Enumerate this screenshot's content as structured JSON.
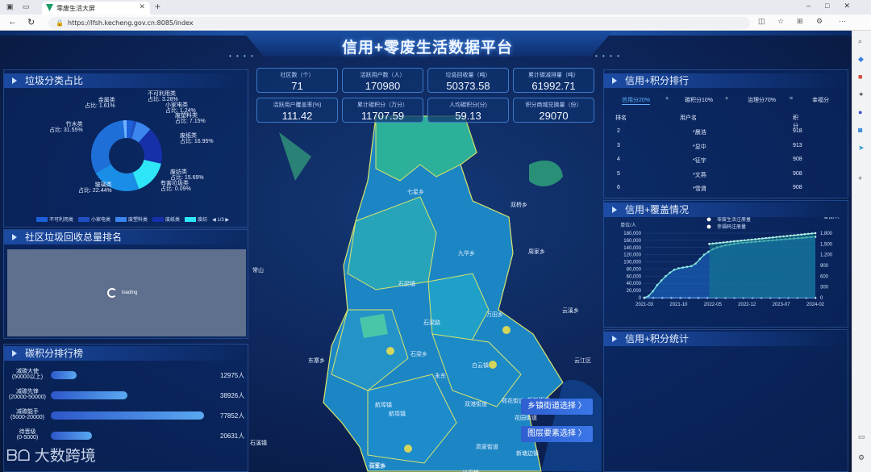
{
  "browser": {
    "tab_title": "零废生活大屏",
    "url": "https://lfsh.kecheng.gov.cn:8085/index"
  },
  "header": {
    "title": "信用+零废生活数据平台"
  },
  "stats": [
    {
      "label": "社区数（个）",
      "value": "71"
    },
    {
      "label": "活跃用户数（人）",
      "value": "170980"
    },
    {
      "label": "垃圾回收量（吨）",
      "value": "50373.58"
    },
    {
      "label": "累计碳减排量（吨）",
      "value": "61992.71"
    },
    {
      "label": "活跃用户覆盖率(%)",
      "value": "111.42"
    },
    {
      "label": "累计碳积分（万分）",
      "value": "11707.59"
    },
    {
      "label": "人均碳积分(分)",
      "value": "59.13"
    },
    {
      "label": "积分商城兑换量（份）",
      "value": "29070"
    }
  ],
  "waste_panel": {
    "title": "垃圾分类占比",
    "slices": [
      {
        "name": "不可利用类",
        "pct": "占比: 3.28%",
        "value": 3.28,
        "color": "#1d5fd8"
      },
      {
        "name": "小家电类",
        "pct": "占比: 1.24%",
        "value": 1.24,
        "color": "#1f4fc0"
      },
      {
        "name": "废塑料类",
        "pct": "占比: 7.15%",
        "value": 7.15,
        "color": "#3a85ee"
      },
      {
        "name": "废纸类",
        "pct": "占比: 16.95%",
        "value": 16.95,
        "color": "#1530a8"
      },
      {
        "name": "废纺类",
        "pct": "占比: 15.69%",
        "value": 15.69,
        "color": "#2ee6f7"
      },
      {
        "name": "有害垃圾类",
        "pct": "占比: 0.09%",
        "value": 0.09,
        "color": "#52c7ff"
      },
      {
        "name": "玻璃类",
        "pct": "占比: 22.44%",
        "value": 22.44,
        "color": "#1a8ee6"
      },
      {
        "name": "竹木类",
        "pct": "占比: 31.55%",
        "value": 31.55,
        "color": "#1e70d8"
      },
      {
        "name": "金属类",
        "pct": "占比: 1.61%",
        "value": 1.61,
        "color": "#6fb4ff"
      }
    ],
    "legend": [
      "不可利用类",
      "小家电类",
      "废塑料类",
      "废纸类",
      "废纺"
    ],
    "legend_page": "1/3"
  },
  "community_panel": {
    "title": "社区垃圾回收总量排名",
    "loading": "loading"
  },
  "carbon_panel": {
    "title": "碳积分排行榜",
    "rows": [
      {
        "name": "减碳大使",
        "range": "(50000以上)",
        "value": "12975人",
        "frac": 0.17
      },
      {
        "name": "减碳先锋",
        "range": "(20000-50000)",
        "value": "38926人",
        "frac": 0.5
      },
      {
        "name": "减碳能手",
        "range": "(5000-20000)",
        "value": "77852人",
        "frac": 1.0
      },
      {
        "name": "待晋级",
        "range": "(0-5000)",
        "value": "20631人",
        "frac": 0.27
      }
    ]
  },
  "rank_panel": {
    "title": "信用+积分排行",
    "formula": [
      "信用分20%",
      "+",
      "碳积分10%",
      "+",
      "治理分70%",
      "=",
      "幸福分"
    ],
    "headers": [
      "排名",
      "用户名",
      "积分"
    ],
    "rows": [
      {
        "rank": "2",
        "user": "*晨浩",
        "score": "918"
      },
      {
        "rank": "3",
        "user": "*显中",
        "score": "913"
      },
      {
        "rank": "4",
        "user": "*征宇",
        "score": "908"
      },
      {
        "rank": "5",
        "user": "*文燕",
        "score": "908"
      },
      {
        "rank": "6",
        "user": "*雪渭",
        "score": "908"
      }
    ]
  },
  "coverage_panel": {
    "title": "信用+覆盖情况"
  },
  "chart_data": {
    "type": "line",
    "series": [
      {
        "name": "零废生活注册量",
        "axis": "left"
      },
      {
        "name": "幸福码注册量",
        "axis": "right"
      }
    ],
    "ylabel_left": "单位/人",
    "ylabel_right": "单位/人",
    "y_ticks_left": [
      "180,000",
      "160,000",
      "140,000",
      "120,000",
      "100,000",
      "80,000",
      "60,000",
      "40,000",
      "20,000",
      "0"
    ],
    "y_ticks_right": [
      "1,800",
      "1,500",
      "1,200",
      "900",
      "600",
      "300",
      "0"
    ],
    "x_ticks": [
      "2021-03",
      "2021-10",
      "2022-05",
      "2022-12",
      "2023-07",
      "2024-02"
    ],
    "ylim_left": [
      0,
      180000
    ],
    "ylim_right": [
      0,
      1800
    ],
    "zero_series": [
      0,
      0,
      0,
      0,
      0,
      0,
      0,
      0,
      0,
      0,
      0,
      0,
      0,
      0,
      0,
      0,
      0,
      0,
      0,
      0,
      0,
      0,
      0,
      0,
      0,
      0,
      0,
      0,
      0,
      0,
      0,
      0,
      0,
      0,
      0,
      0,
      0,
      0,
      0,
      0,
      0,
      0,
      0,
      0,
      0,
      0,
      0,
      0,
      0,
      0,
      0,
      0,
      0,
      0,
      0,
      0,
      0,
      0,
      0,
      0
    ],
    "left_series": [
      0,
      5000,
      18000,
      35000,
      48000,
      60000,
      70000,
      78000,
      82000,
      84000,
      86000,
      88000,
      95000,
      108000,
      120000,
      128000,
      135000,
      140000,
      143000,
      146000,
      148000,
      150000,
      152000,
      153000,
      154000,
      155000,
      156000,
      157000,
      158000,
      159000,
      160000,
      161000,
      162000,
      163000,
      164000,
      165000,
      166000,
      167000,
      168000,
      169000,
      170000
    ],
    "right_series": [
      1500,
      1510,
      1520,
      1530,
      1540,
      1550,
      1560,
      1570,
      1580,
      1590,
      1600,
      1610,
      1620,
      1630,
      1640,
      1650,
      1660,
      1670,
      1680,
      1690,
      1700,
      1710,
      1720,
      1730,
      1740,
      1750,
      1760,
      1770,
      1780,
      1790,
      1800
    ]
  },
  "stats_panel": {
    "title": "信用+积分统计"
  },
  "map": {
    "buttons": [
      "乡镇街道选择 〉",
      "图层要素选择 〉"
    ],
    "labels": [
      "七星乡",
      "双桥乡",
      "九华乡",
      "石梁镇",
      "周家乡",
      "万田乡",
      "云溪乡",
      "东寨乡",
      "白云镇",
      "云江区",
      "石梁路",
      "石溪镇",
      "航埠镇",
      "双港街道",
      "荷花街道",
      "新杉街道",
      "高家街道",
      "花园街道",
      "石室乡",
      "廿里镇",
      "黄家乡",
      "新塘边镇",
      "航埠镇",
      "石梁乡",
      "常山",
      "永东"
    ]
  },
  "watermark": "大数跨境"
}
